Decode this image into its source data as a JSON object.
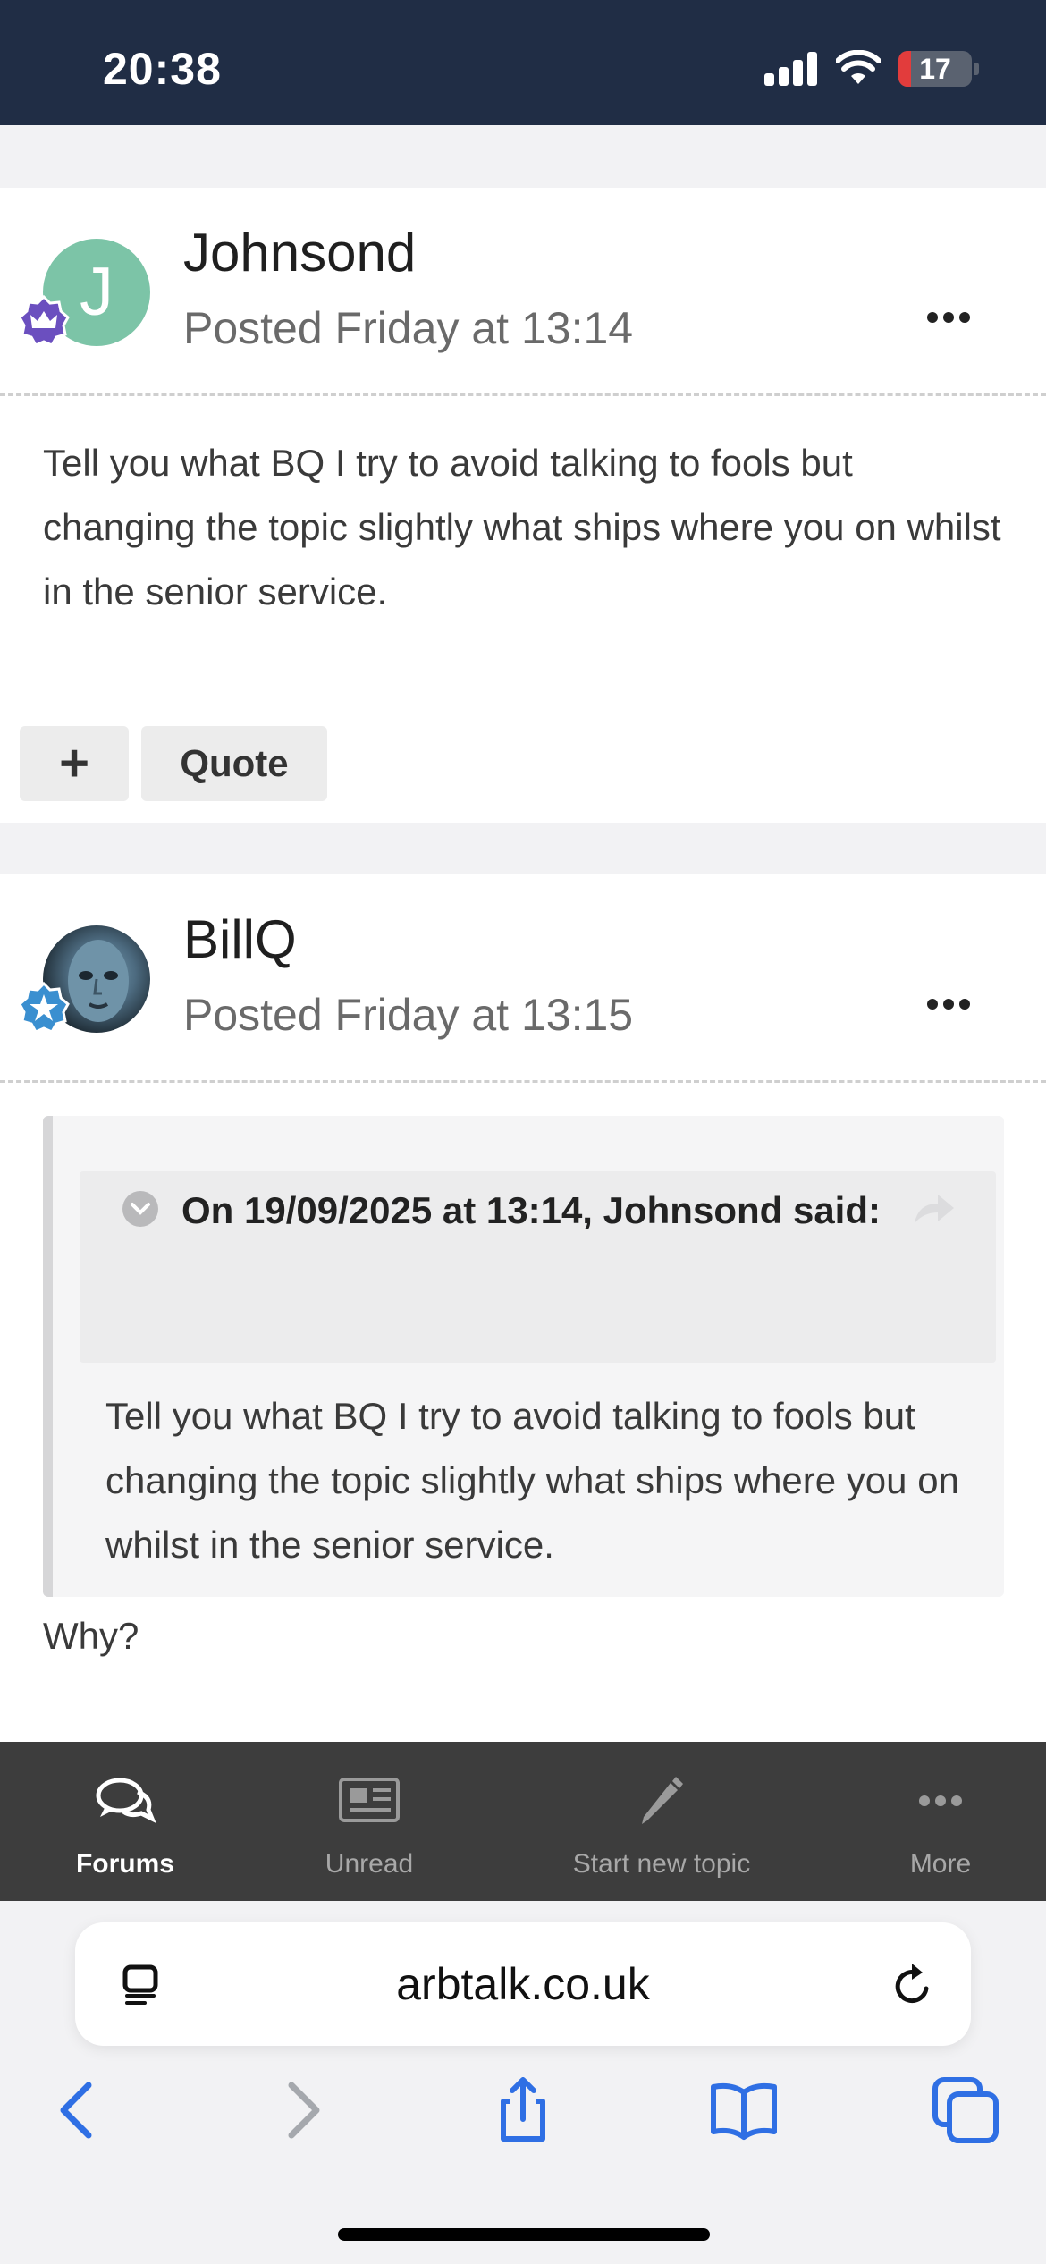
{
  "status_bar": {
    "time": "20:38",
    "battery_level": "17",
    "battery_fraction": 0.17
  },
  "posts": [
    {
      "author": "Johnsond",
      "avatar_letter": "J",
      "posted": "Posted Friday at 13:14",
      "body": "Tell you what BQ I try to avoid talking to fools but changing the topic slightly what ships where you on whilst in the senior service.",
      "actions": {
        "plus_label": "+",
        "quote_label": "Quote"
      },
      "badge_icon": "crown-badge-icon"
    },
    {
      "author": "BillQ",
      "posted": "Posted Friday at 13:15",
      "badge_icon": "star-badge-icon",
      "quote": {
        "header": "On 19/09/2025 at 13:14, Johnsond said:",
        "text": "Tell you what BQ I try to avoid talking to fools but changing the topic slightly what ships where you on whilst in the senior service."
      },
      "body": "Why?"
    }
  ],
  "bottom_nav": {
    "items": [
      {
        "label": "Forums",
        "icon": "chat-bubbles-icon",
        "active": true
      },
      {
        "label": "Unread",
        "icon": "newspaper-icon",
        "active": false
      },
      {
        "label": "Start new topic",
        "icon": "pencil-icon",
        "active": false
      },
      {
        "label": "More",
        "icon": "more-dots-icon",
        "active": false
      }
    ]
  },
  "browser": {
    "url": "arbtalk.co.uk",
    "accent_color": "#2f6fe4"
  }
}
